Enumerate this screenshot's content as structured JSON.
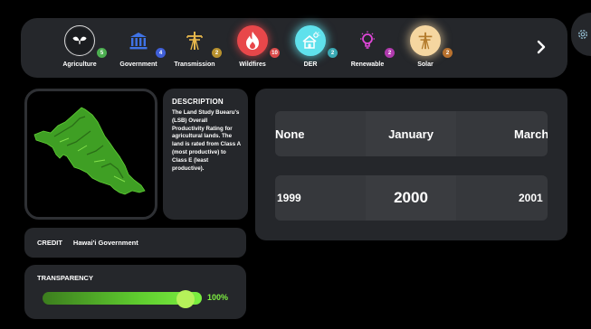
{
  "categories": [
    {
      "label": "Agriculture",
      "count": "5",
      "circle_bg": "#ffffff",
      "icon_color": "#23272b",
      "badge_color": "#4caf50",
      "icon": "leaf-icon"
    },
    {
      "label": "Government",
      "count": "4",
      "circle_bg": "transparent",
      "icon_color": "#3f73e6",
      "badge_color": "#3f5fd8",
      "icon": "government-building-icon"
    },
    {
      "label": "Transmission",
      "count": "2",
      "circle_bg": "transparent",
      "icon_color": "#e8b84c",
      "badge_color": "#b8912e",
      "icon": "transmission-tower-icon"
    },
    {
      "label": "Wildfires",
      "count": "10",
      "circle_bg": "#e8474a",
      "icon_color": "#ffffff",
      "badge_color": "#d94a4a",
      "icon": "flame-icon"
    },
    {
      "label": "DER",
      "count": "2",
      "circle_bg": "#5fe1ec",
      "icon_color": "#ffffff",
      "badge_color": "#3aa9b4",
      "icon": "solar-house-icon"
    },
    {
      "label": "Renewable",
      "count": "2",
      "circle_bg": "transparent",
      "icon_color": "#e046d8",
      "badge_color": "#b03aad",
      "icon": "lightbulb-icon"
    },
    {
      "label": "Solar",
      "count": "2",
      "circle_bg": "#f5d6a0",
      "icon_color": "#b27a2a",
      "badge_color": "#b8712e",
      "icon": "transmission-tower-icon"
    }
  ],
  "description": {
    "title": "DESCRIPTION",
    "body": "The Land Study Buearu's (LSB) Overall Productivity Rating for agricultural lands. The land is rated from Class A (most productive) to Class E (least productive)."
  },
  "picker": {
    "months": [
      "None",
      "January",
      "March"
    ],
    "years": [
      "1999",
      "2000",
      "2001"
    ]
  },
  "credit": {
    "label": "CREDIT",
    "value": "Hawai'i Government"
  },
  "transparency": {
    "label": "TRANSPARENCY",
    "value_text": "100%",
    "level": 0.9
  },
  "colors": {
    "accent": "#7df041",
    "panel": "#25272b",
    "map_fill": "#3f9f24"
  }
}
